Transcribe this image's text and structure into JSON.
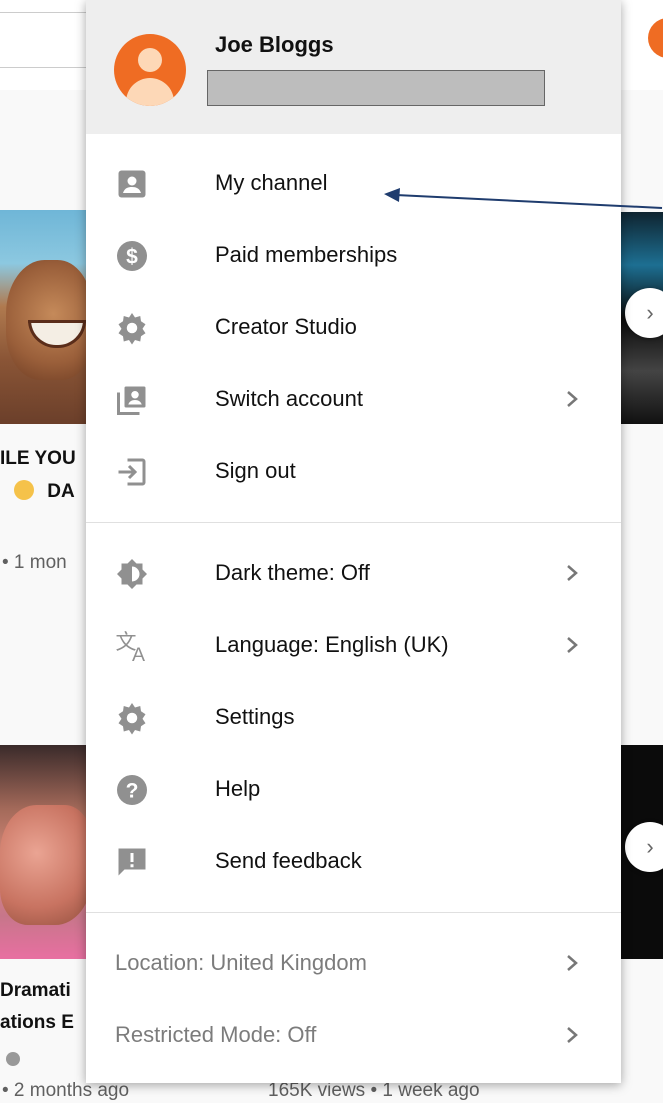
{
  "account": {
    "name": "Joe Bloggs"
  },
  "menu": {
    "primary": [
      {
        "label": "My channel",
        "icon": "account-box-icon"
      },
      {
        "label": "Paid memberships",
        "icon": "dollar-circle-icon"
      },
      {
        "label": "Creator Studio",
        "icon": "gear-icon"
      },
      {
        "label": "Switch account",
        "icon": "switch-account-icon",
        "chevron": true
      },
      {
        "label": "Sign out",
        "icon": "exit-icon"
      }
    ],
    "secondary": [
      {
        "label": "Dark theme: Off",
        "icon": "dark-theme-icon",
        "chevron": true
      },
      {
        "label": "Language: English (UK)",
        "icon": "translate-icon",
        "chevron": true
      },
      {
        "label": "Settings",
        "icon": "settings-icon"
      },
      {
        "label": "Help",
        "icon": "help-icon"
      },
      {
        "label": "Send feedback",
        "icon": "feedback-icon"
      }
    ],
    "footer": [
      {
        "label": "Location: United Kingdom",
        "chevron": true
      },
      {
        "label": "Restricted Mode: Off",
        "chevron": true
      }
    ]
  },
  "background": {
    "video1_title_line1": "ILE YOU",
    "video1_title_line2": "DA",
    "video1_meta": "• 1 mon",
    "video2_title_line1": "Dramati",
    "video2_title_line2": "ations E",
    "video2_meta": "• 2 months ago",
    "video3_meta": "165K views • 1 week ago"
  },
  "colors": {
    "avatar": "#ef6c23",
    "icon_gray": "#909090",
    "header_bg": "#eeeeee",
    "annotation_arrow": "#1f3c6e"
  }
}
